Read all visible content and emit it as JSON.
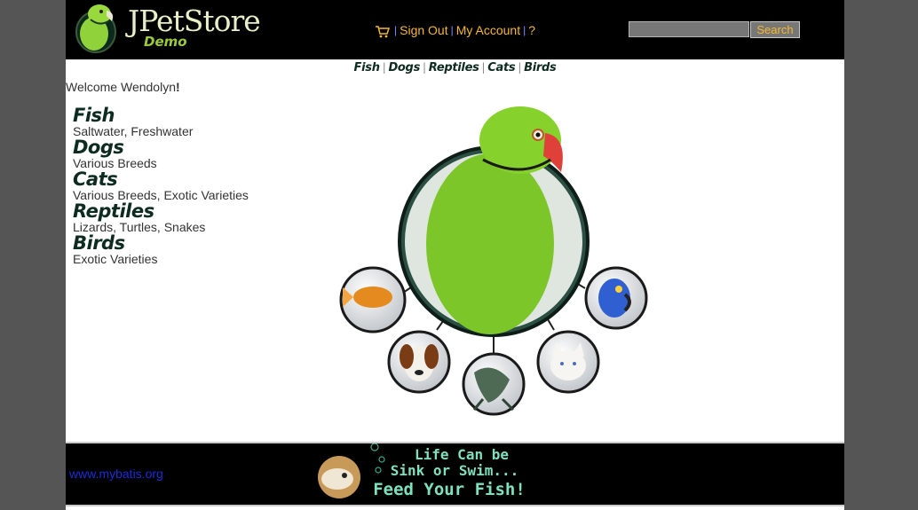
{
  "header": {
    "logo_title": "JPetStore",
    "logo_subtitle": "Demo",
    "menu": {
      "cart_icon": "cart-icon",
      "sign_out": "Sign Out",
      "my_account": "My Account",
      "help": "?",
      "separator": "|"
    },
    "search": {
      "value": "",
      "button_label": "Search"
    }
  },
  "quicklinks": [
    "Fish",
    "Dogs",
    "Reptiles",
    "Cats",
    "Birds"
  ],
  "welcome": {
    "prefix": "Welcome ",
    "name": "Wendolyn",
    "suffix": "!"
  },
  "sidebar": {
    "categories": [
      {
        "name": "Fish",
        "description": "Saltwater, Freshwater"
      },
      {
        "name": "Dogs",
        "description": "Various Breeds"
      },
      {
        "name": "Cats",
        "description": "Various Breeds, Exotic Varieties"
      },
      {
        "name": "Reptiles",
        "description": "Lizards, Turtles, Snakes"
      },
      {
        "name": "Birds",
        "description": "Exotic Varieties"
      }
    ]
  },
  "footer": {
    "link_text": "www.mybatis.org",
    "banner_lines": [
      "Life Can be",
      "Sink or Swim...",
      "Feed Your Fish!"
    ]
  },
  "colors": {
    "header_bg": "#000000",
    "menu_link": "#f5b82e",
    "category_title": "#0e2b22",
    "footer_link": "#1a2dd6",
    "parrot_green": "#7cc62a",
    "banner_text": "#7fe0c0"
  }
}
